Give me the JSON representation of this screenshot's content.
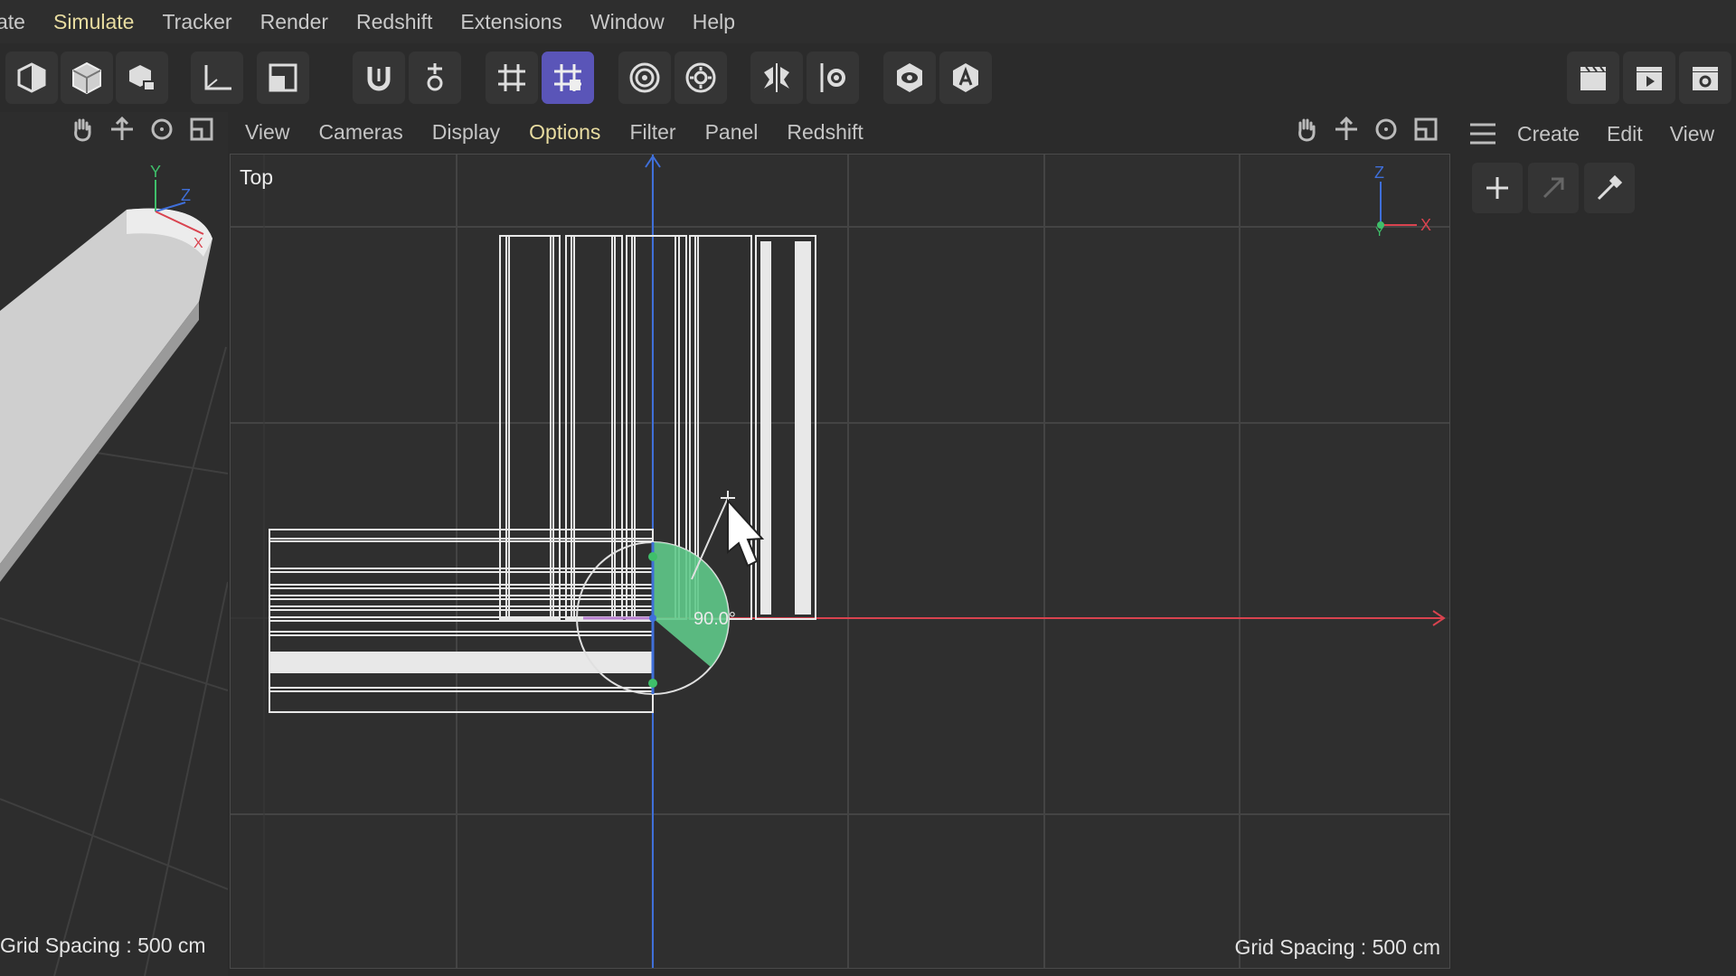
{
  "menubar": {
    "items": [
      {
        "label": "ate",
        "active": false
      },
      {
        "label": "Simulate",
        "active": true
      },
      {
        "label": "Tracker",
        "active": false
      },
      {
        "label": "Render",
        "active": false
      },
      {
        "label": "Redshift",
        "active": false
      },
      {
        "label": "Extensions",
        "active": false
      },
      {
        "label": "Window",
        "active": false
      },
      {
        "label": "Help",
        "active": false
      }
    ]
  },
  "toolbar": {
    "icons": [
      "cube-icon",
      "cube-solid-icon",
      "generator-icon",
      "axis-icon",
      "frame-icon",
      "magnet-icon",
      "snap-settings-icon",
      "grid-snap-icon",
      "grid-snap-active-icon",
      "target-icon",
      "gear-target-icon",
      "symmetry-icon",
      "symmetry-settings-icon",
      "visibility-icon",
      "attribute-icon",
      "clapboard-icon",
      "render-viewport-icon",
      "render-settings-icon"
    ],
    "selected_icon": "grid-snap-active-icon"
  },
  "viewport_menu": {
    "items": [
      {
        "label": "View",
        "active": false
      },
      {
        "label": "Cameras",
        "active": false
      },
      {
        "label": "Display",
        "active": false
      },
      {
        "label": "Options",
        "active": true
      },
      {
        "label": "Filter",
        "active": false
      },
      {
        "label": "Panel",
        "active": false
      },
      {
        "label": "Redshift",
        "active": false
      }
    ]
  },
  "right_menu": {
    "items": [
      {
        "label": "Create"
      },
      {
        "label": "Edit"
      },
      {
        "label": "View"
      }
    ]
  },
  "main_viewport": {
    "name": "Top",
    "grid_spacing": "Grid Spacing : 500 cm",
    "rotation_readout": "90.0°",
    "axis_labels": {
      "z": "Z",
      "y": "Y",
      "x": "X"
    }
  },
  "left_viewport": {
    "grid_spacing": "Grid Spacing : 500 cm",
    "axis_labels": {
      "y": "Y",
      "z": "Z",
      "x": "X"
    }
  },
  "colors": {
    "accent_active_text": "#e8dca0",
    "selected_button": "#5a55b8",
    "x_axis": "#d9434f",
    "y_axis": "#3fbf6a",
    "z_axis": "#3f6fd9",
    "rotation_fill": "#5fc98a"
  }
}
